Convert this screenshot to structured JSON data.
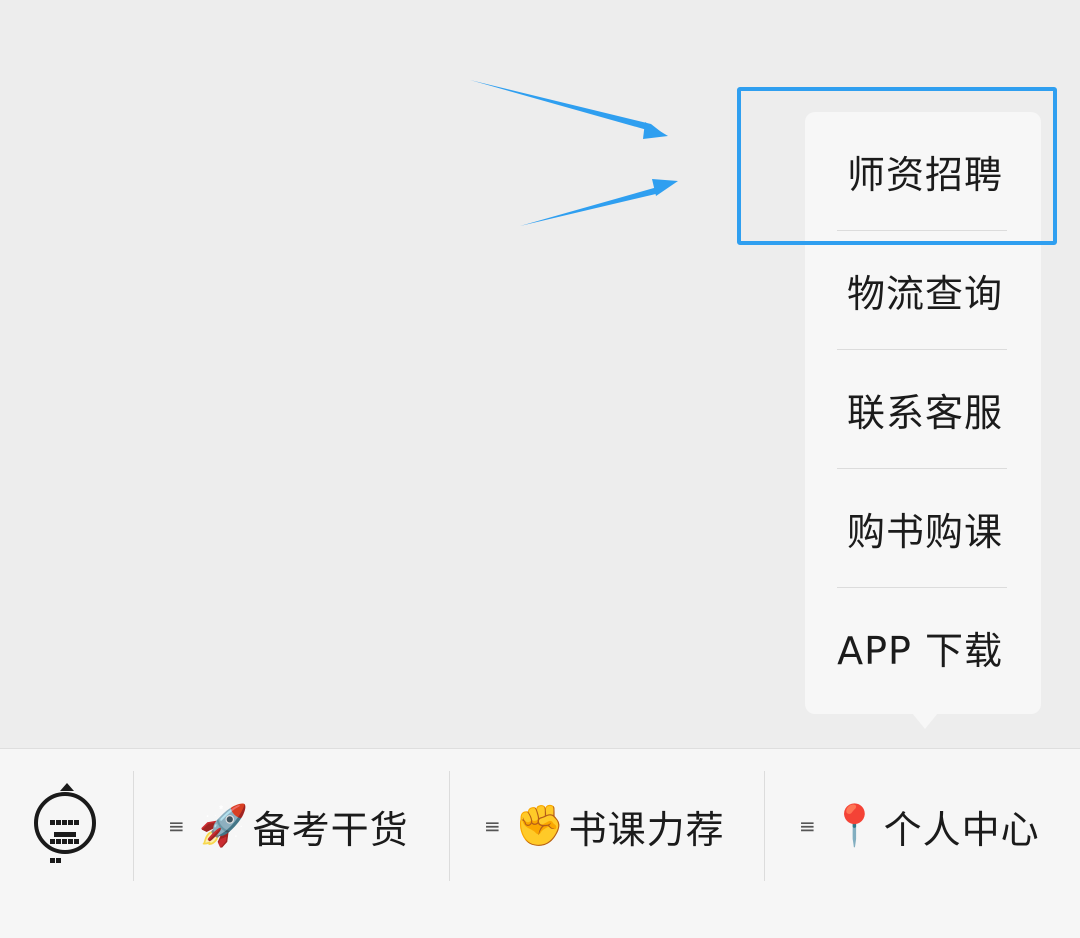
{
  "menu": {
    "items": [
      {
        "label": "师资招聘"
      },
      {
        "label": "物流查询"
      },
      {
        "label": "联系客服"
      },
      {
        "label": "购书购课"
      },
      {
        "label": "APP 下载"
      }
    ]
  },
  "bottom_bar": {
    "keyboard_icon": "keyboard-icon",
    "tabs": [
      {
        "menu_glyph": "≡",
        "emoji": "🚀",
        "label": "备考干货"
      },
      {
        "menu_glyph": "≡",
        "emoji": "✊",
        "label": "书课力荐"
      },
      {
        "menu_glyph": "≡",
        "emoji": "📍",
        "label": "个人中心"
      }
    ]
  },
  "colors": {
    "highlight": "#2f9ff0",
    "arrow": "#2f9ff0",
    "background": "#ededed",
    "menu_bg": "#f7f7f7"
  }
}
